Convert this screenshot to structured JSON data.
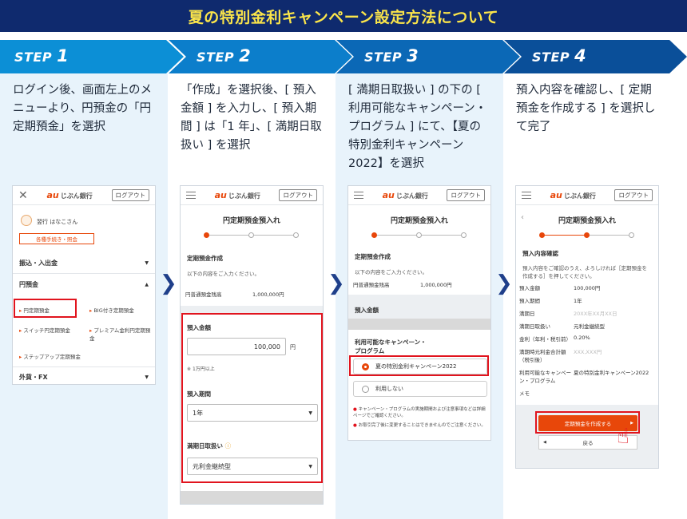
{
  "banner": {
    "title": "夏の特別金利キャンペーン設定方法について"
  },
  "steps": [
    {
      "label": "STEP",
      "num": "1",
      "text": "ログイン後、画面左上のメニューより、円預金の「円定期預金」を選択"
    },
    {
      "label": "STEP",
      "num": "2",
      "text": "「作成」を選択後、[ 預入金額 ] を入力し、[ 預入期間 ] は「1 年」、[ 満期日取扱い ] を選択"
    },
    {
      "label": "STEP",
      "num": "3",
      "text": "[ 満期日取扱い ] の下の [ 利用可能なキャンペーン・プログラム ] にて、【夏の特別金利キャンペーン 2022】を選択"
    },
    {
      "label": "STEP",
      "num": "4",
      "text": "預入内容を確認し、[ 定期預金を作成する ] を選択して完了"
    }
  ],
  "common": {
    "bank_logo_au": "au",
    "bank_logo_name": "じぶん銀行",
    "logout": "ログアウト",
    "page_title": "円定期預金預入れ"
  },
  "phone1": {
    "user_name": "翌行 はなこさん",
    "procedures_button": "各種手続き・照会",
    "menu_transfer": "振込・入出金",
    "menu_yen": "円預金",
    "sub_fixed": "円定期預金",
    "sub_big": "BIG付き定期預金",
    "sub_switch": "スイッチ円定期預金",
    "sub_premium": "プレミアム金利円定期預金",
    "sub_stepup": "ステップアップ定期預金",
    "menu_fx": "外貨・FX"
  },
  "phone2": {
    "section": "定期預金作成",
    "instruction": "以下の内容をご入力ください。",
    "balance_label": "円普通預金残高",
    "balance_value": "1,000,000円",
    "amount_label": "預入金額",
    "amount_value": "100,000",
    "amount_unit": "円",
    "amount_note": "1万円以上",
    "term_label": "預入期間",
    "term_value": "1年",
    "maturity_label": "満期日取扱い",
    "maturity_value": "元利金継続型"
  },
  "phone3": {
    "section": "定期預金作成",
    "instruction": "以下の内容をご入力ください。",
    "balance_label": "円普通預金残高",
    "balance_value": "1,000,000円",
    "amount_label": "預入金額",
    "campaign_label": "利用可能なキャンペーン・プログラム",
    "option_campaign": "夏の特別金利キャンペーン2022",
    "option_none": "利用しない",
    "note1": "キャンペーン・プログラムの実施期間および注意事項などは詳細ページでご確認ください。",
    "note2": "お取引完了後に変更することはできませんのでご注意ください。"
  },
  "phone4": {
    "section": "預入内容確認",
    "instruction": "預入内容をご確認のうえ、よろしければ［定期預金を作成する］を押してください。",
    "rows": [
      {
        "k": "預入金額",
        "v": "100,000円"
      },
      {
        "k": "預入期間",
        "v": "1年"
      },
      {
        "k": "満期日",
        "v": "20XX年XX月XX日"
      },
      {
        "k": "満期日取扱い",
        "v": "元利金継続型"
      },
      {
        "k": "金利（年利・税引前）",
        "v": "0.20%"
      },
      {
        "k": "満期時元利金合計額（税引後）",
        "v": "XXX,XXX円"
      },
      {
        "k": "利用可能なキャンペーン・プログラム",
        "v": "夏の特別金利キャンペーン2022"
      },
      {
        "k": "メモ",
        "v": ""
      }
    ],
    "create_button": "定期預金を作成する",
    "back_button": "戻る"
  },
  "colors": {
    "navy": "#0f2a6e",
    "yellow": "#fbe54a",
    "orange": "#e8470a",
    "red": "#e1141e",
    "step_blue": "#0c8fd6"
  }
}
